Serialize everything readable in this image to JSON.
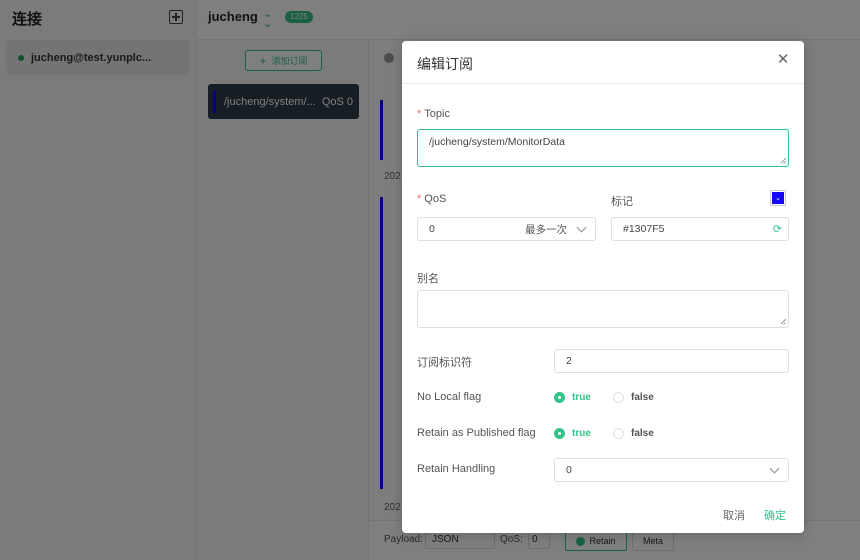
{
  "sidebar": {
    "title": "连接",
    "connections": [
      {
        "name": "jucheng@test.yunplc..."
      }
    ]
  },
  "topbar": {
    "title": "jucheng",
    "badge": "1225"
  },
  "subscriptions": {
    "add_label": "添加订阅",
    "items": [
      {
        "topic": "/jucheng/system/...",
        "qos": "QoS 0",
        "color": "#1307F5"
      }
    ]
  },
  "messages": {
    "date_fragment_1": "202",
    "date_fragment_2": "202"
  },
  "compose": {
    "payload_label": "Payload:",
    "payload_format": "JSON",
    "qos_label": "QoS:",
    "qos_value": "0",
    "retain_label": "Retain",
    "meta_label": "Meta"
  },
  "dialog": {
    "title": "编辑订阅",
    "topic": {
      "label": "Topic",
      "value": "/jucheng/system/MonitorData"
    },
    "qos": {
      "label": "QoS",
      "value": "0",
      "value_text": "最多一次"
    },
    "tag": {
      "label": "标记",
      "color": "#1307F5"
    },
    "alias": {
      "label": "别名",
      "value": ""
    },
    "sub_id": {
      "label": "订阅标识符",
      "value": "2"
    },
    "no_local": {
      "label": "No Local flag",
      "selected": "true",
      "options": [
        "true",
        "false"
      ]
    },
    "rap": {
      "label": "Retain as Published flag",
      "selected": "true",
      "options": [
        "true",
        "false"
      ]
    },
    "retain_handling": {
      "label": "Retain Handling",
      "value": "0"
    },
    "cancel_label": "取消",
    "confirm_label": "确定"
  }
}
